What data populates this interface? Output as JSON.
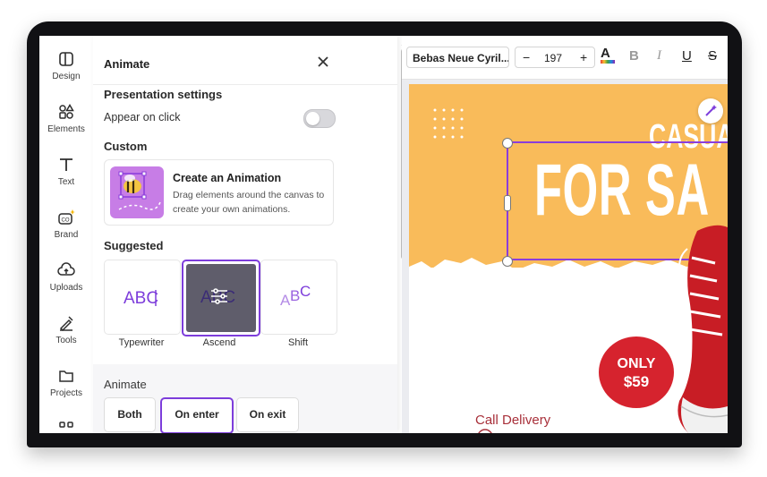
{
  "rail": [
    {
      "label": "Design",
      "icon": "design-icon"
    },
    {
      "label": "Elements",
      "icon": "elements-icon"
    },
    {
      "label": "Text",
      "icon": "text-icon"
    },
    {
      "label": "Brand",
      "icon": "brand-icon"
    },
    {
      "label": "Uploads",
      "icon": "uploads-icon"
    },
    {
      "label": "Tools",
      "icon": "tools-icon"
    },
    {
      "label": "Projects",
      "icon": "projects-icon"
    }
  ],
  "panel": {
    "title": "Animate",
    "presentation_heading": "Presentation settings",
    "appear_on_click": "Appear on click",
    "appear_on_click_enabled": false,
    "custom_heading": "Custom",
    "create_title": "Create an Animation",
    "create_desc": "Drag elements around the canvas to create your own animations.",
    "suggested_heading": "Suggested",
    "suggested": [
      {
        "label": "Typewriter",
        "preview": "ABC",
        "selected": false
      },
      {
        "label": "Ascend",
        "preview": "ABC",
        "selected": true
      },
      {
        "label": "Shift",
        "preview": "ABC",
        "selected": false
      }
    ],
    "animate_heading": "Animate",
    "animate_options": [
      {
        "label": "Both",
        "selected": false
      },
      {
        "label": "On enter",
        "selected": true
      },
      {
        "label": "On exit",
        "selected": false
      }
    ]
  },
  "toolbar": {
    "font_name": "Bebas Neue Cyril...",
    "font_size": "197",
    "minus": "−",
    "plus": "+",
    "text_color_letter": "A",
    "bold": "B",
    "italic": "I",
    "underline": "U",
    "strike": "S"
  },
  "canvas": {
    "line1": "CASUA",
    "line2": "FOR SA",
    "badge_line1": "ONLY",
    "badge_line2": "$59",
    "call": "Call Delivery"
  },
  "colors": {
    "accent": "#7d3ddb",
    "orange": "#f9bb5a",
    "badge_red": "#d6232e"
  }
}
